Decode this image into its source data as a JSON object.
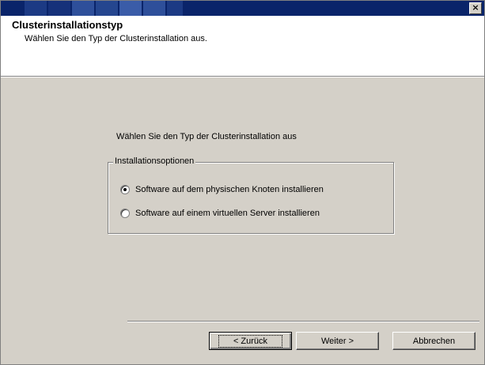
{
  "window": {
    "close_glyph": "×",
    "titlebar_colors": [
      "#0a246a",
      "#1c3a84",
      "#2e4f9a",
      "#3a5ca8"
    ]
  },
  "header": {
    "title": "Clusterinstallationstyp",
    "subtitle": "Wählen Sie den Typ der Clusterinstallation aus."
  },
  "main": {
    "prompt": "Wählen Sie den Typ der Clusterinstallation aus",
    "group_label": "Installationsoptionen",
    "options": [
      {
        "label": "Software auf dem physischen Knoten installieren",
        "checked": true
      },
      {
        "label": "Software auf einem virtuellen Server installieren",
        "checked": false
      }
    ]
  },
  "buttons": {
    "back": "< Zurück",
    "next": "Weiter >",
    "cancel": "Abbrechen"
  }
}
